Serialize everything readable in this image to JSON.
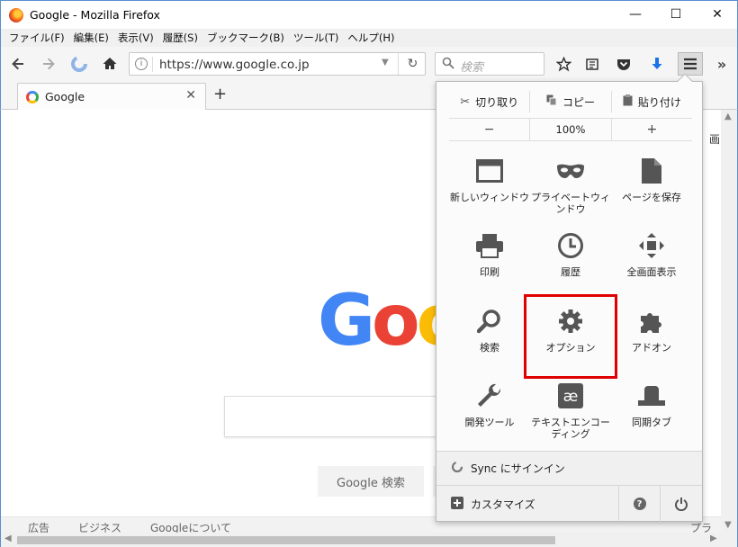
{
  "window": {
    "title": "Google - Mozilla Firefox",
    "min": "—",
    "max": "☐",
    "close": "✕"
  },
  "menu": [
    "ファイル(F)",
    "編集(E)",
    "表示(V)",
    "履歴(S)",
    "ブックマーク(B)",
    "ツール(T)",
    "ヘルプ(H)"
  ],
  "navbar": {
    "url": "https://www.google.co.jp",
    "search_placeholder": "検索"
  },
  "tab": {
    "title": "Google"
  },
  "page": {
    "logo_letters": [
      "G",
      "o",
      "o"
    ],
    "search_button": "Google 検索",
    "footer": [
      "広告",
      "ビジネス",
      "Googleについて",
      "プライ"
    ],
    "cutoff": "画"
  },
  "panel": {
    "edit": {
      "cut": "切り取り",
      "copy": "コピー",
      "paste": "貼り付け"
    },
    "zoom": {
      "minus": "−",
      "level": "100%",
      "plus": "+"
    },
    "items": [
      {
        "label": "新しいウィンドウ",
        "icon": "new-window-icon"
      },
      {
        "label": "プライベートウィンドウ",
        "icon": "private-mask-icon"
      },
      {
        "label": "ページを保存",
        "icon": "save-page-icon"
      },
      {
        "label": "印刷",
        "icon": "print-icon"
      },
      {
        "label": "履歴",
        "icon": "history-clock-icon"
      },
      {
        "label": "全画面表示",
        "icon": "fullscreen-icon"
      },
      {
        "label": "検索",
        "icon": "search-icon"
      },
      {
        "label": "オプション",
        "icon": "gear-icon",
        "highlighted": true
      },
      {
        "label": "アドオン",
        "icon": "puzzle-icon"
      },
      {
        "label": "開発ツール",
        "icon": "wrench-icon"
      },
      {
        "label": "テキストエンコーディング",
        "icon": "text-encoding-icon"
      },
      {
        "label": "同期タブ",
        "icon": "synced-tabs-icon"
      }
    ],
    "sync_label": "Sync にサインイン",
    "customize_label": "カスタマイズ",
    "help_glyph": "?"
  },
  "colors": {
    "highlight": "#e00000",
    "accent_blue": "#5a8fd0"
  }
}
